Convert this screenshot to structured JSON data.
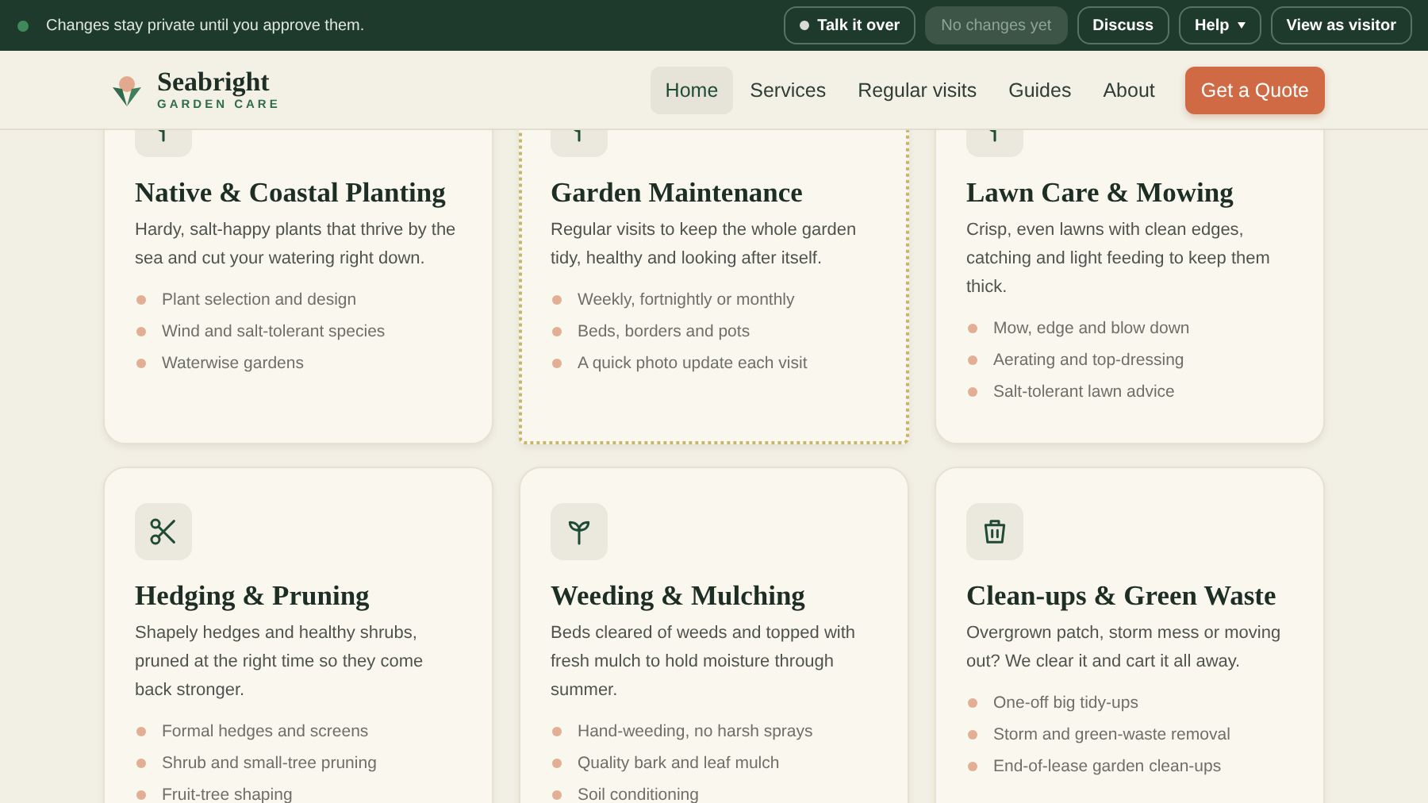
{
  "notice_bar": {
    "message": "Changes stay private until you approve them.",
    "buttons": [
      {
        "label": "Talk it over",
        "kind": "dot",
        "disabled": false
      },
      {
        "label": "No changes yet",
        "kind": "plain",
        "disabled": true
      },
      {
        "label": "Discuss",
        "kind": "plain",
        "disabled": false
      },
      {
        "label": "Help",
        "kind": "menu",
        "disabled": false
      },
      {
        "label": "View as visitor",
        "kind": "plain",
        "disabled": false
      }
    ]
  },
  "header": {
    "brand": {
      "name": "Seabright",
      "tagline": "GARDEN CARE"
    },
    "nav": [
      {
        "label": "Home",
        "selected": true
      },
      {
        "label": "Services",
        "selected": false
      },
      {
        "label": "Regular visits",
        "selected": false
      },
      {
        "label": "Guides",
        "selected": false
      },
      {
        "label": "About",
        "selected": false
      }
    ],
    "cta": "Get a Quote"
  },
  "services": [
    {
      "title": "Native & Coastal Planting",
      "description": "Hardy, salt-happy plants that thrive by the sea and cut your watering right down.",
      "points": [
        "Plant selection and design",
        "Wind and salt-tolerant species",
        "Waterwise gardens"
      ],
      "selected": false
    },
    {
      "title": "Garden Maintenance",
      "description": "Regular visits to keep the whole garden tidy, healthy and looking after itself.",
      "points": [
        "Weekly, fortnightly or monthly",
        "Beds, borders and pots",
        "A quick photo update each visit"
      ],
      "selected": true
    },
    {
      "title": "Lawn Care & Mowing",
      "description": "Crisp, even lawns with clean edges, catching and light feeding to keep them thick.",
      "points": [
        "Mow, edge and blow down",
        "Aerating and top-dressing",
        "Salt-tolerant lawn advice"
      ],
      "selected": false
    },
    {
      "title": "Hedging & Pruning",
      "description": "Shapely hedges and healthy shrubs, pruned at the right time so they come back stronger.",
      "points": [
        "Formal hedges and screens",
        "Shrub and small-tree pruning",
        "Fruit-tree shaping"
      ],
      "selected": false
    },
    {
      "title": "Weeding & Mulching",
      "description": "Beds cleared of weeds and topped with fresh mulch to hold moisture through summer.",
      "points": [
        "Hand-weeding, no harsh sprays",
        "Quality bark and leaf mulch",
        "Soil conditioning"
      ],
      "selected": false
    },
    {
      "title": "Clean-ups & Green Waste",
      "description": "Overgrown patch, storm mess or moving out? We clear it and cart it all away.",
      "points": [
        "One-off big tidy-ups",
        "Storm and green-waste removal",
        "End-of-lease garden clean-ups"
      ],
      "selected": false
    }
  ]
}
